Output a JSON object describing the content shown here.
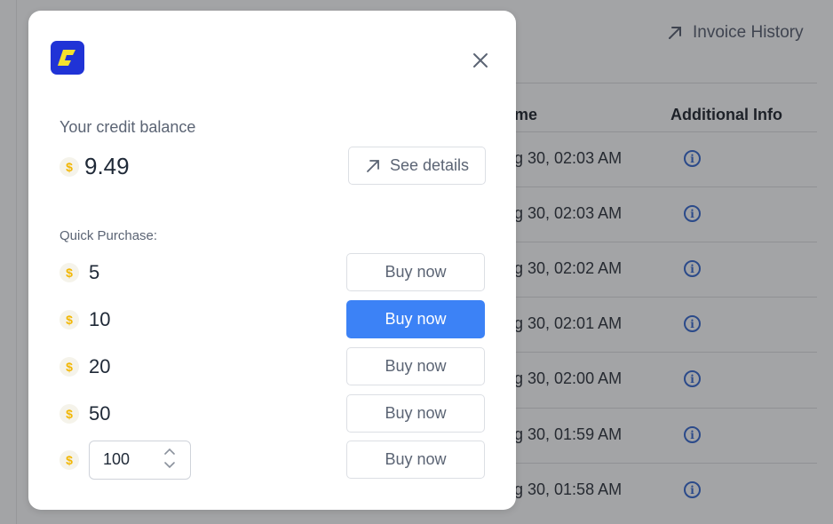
{
  "background": {
    "invoice_history_label": "Invoice History",
    "columns": {
      "time": "me",
      "additional_info": "Additional Info"
    },
    "rows": [
      {
        "time": "g 30, 02:03 AM"
      },
      {
        "time": "g 30, 02:03 AM"
      },
      {
        "time": "g 30, 02:02 AM"
      },
      {
        "time": "g 30, 02:01 AM"
      },
      {
        "time": "g 30, 02:00 AM"
      },
      {
        "time": "g 30, 01:59 AM"
      },
      {
        "time": "g 30, 01:58 AM"
      }
    ],
    "info_icon_glyph": "i"
  },
  "modal": {
    "logo_icon": "brand-logo-icon",
    "balance_label": "Your credit balance",
    "currency_symbol": "$",
    "balance_value": "9.49",
    "see_details_label": "See details",
    "quick_purchase_label": "Quick Purchase:",
    "options": [
      {
        "amount": "5",
        "button": "Buy now"
      },
      {
        "amount": "10",
        "button": "Buy now"
      },
      {
        "amount": "20",
        "button": "Buy now"
      },
      {
        "amount": "50",
        "button": "Buy now"
      }
    ],
    "custom_amount": "100",
    "custom_button": "Buy now"
  },
  "colors": {
    "accent": "#3c82f6",
    "brand": "#2033d6",
    "coin": "#f2b705"
  }
}
